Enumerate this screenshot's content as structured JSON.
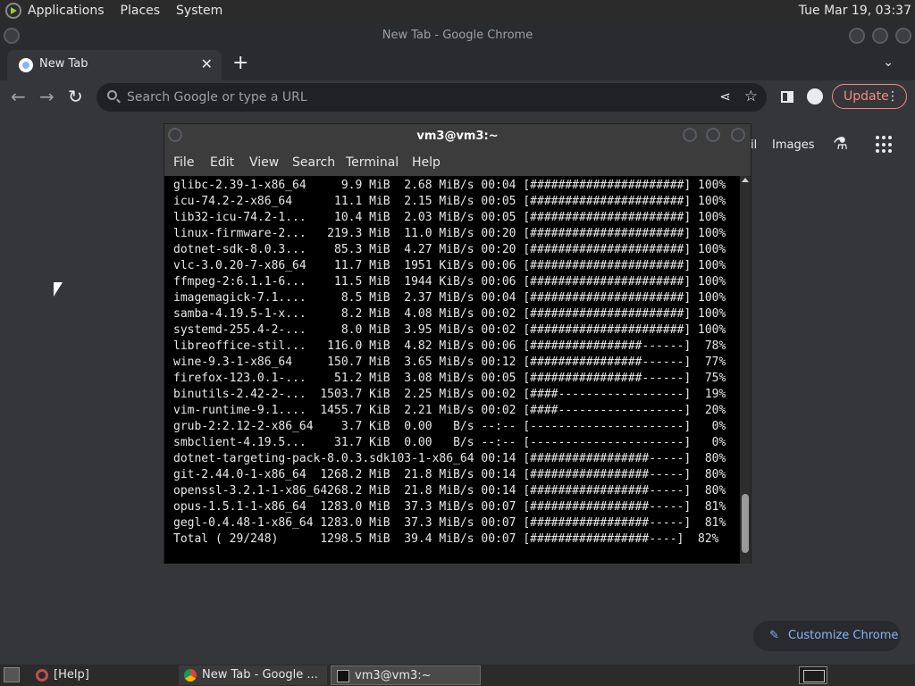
{
  "top_panel": {
    "menus": [
      "Applications",
      "Places",
      "System"
    ],
    "clock": "Tue Mar 19, 03:37"
  },
  "chrome": {
    "window_title": "New Tab - Google Chrome",
    "tab_title": "New Tab",
    "tab_close_glyph": "✕",
    "new_tab_glyph": "+",
    "omnibox_placeholder": "Search Google or type a URL",
    "update_label": "Update",
    "ntp": {
      "gmail_fragment": "il",
      "images_label": "Images",
      "customize_label": "Customize Chrome"
    }
  },
  "terminal": {
    "title": "vm3@vm3:~",
    "menus": [
      "File",
      "Edit",
      "View",
      "Search",
      "Terminal",
      "Help"
    ],
    "lines": [
      "glibc-2.39-1-x86_64     9.9 MiB  2.68 MiB/s 00:04 [######################] 100%",
      "icu-74.2-2-x86_64      11.1 MiB  2.15 MiB/s 00:05 [######################] 100%",
      "lib32-icu-74.2-1...    10.4 MiB  2.03 MiB/s 00:05 [######################] 100%",
      "linux-firmware-2...   219.3 MiB  11.0 MiB/s 00:20 [######################] 100%",
      "dotnet-sdk-8.0.3...    85.3 MiB  4.27 MiB/s 00:20 [######################] 100%",
      "vlc-3.0.20-7-x86_64    11.7 MiB  1951 KiB/s 00:06 [######################] 100%",
      "ffmpeg-2:6.1.1-6...    11.5 MiB  1944 KiB/s 00:06 [######################] 100%",
      "imagemagick-7.1....     8.5 MiB  2.37 MiB/s 00:04 [######################] 100%",
      "samba-4.19.5-1-x...     8.2 MiB  4.08 MiB/s 00:02 [######################] 100%",
      "systemd-255.4-2-...     8.0 MiB  3.95 MiB/s 00:02 [######################] 100%",
      "libreoffice-stil...   116.0 MiB  4.82 MiB/s 00:06 [################------]  78%",
      "wine-9.3-1-x86_64     150.7 MiB  3.65 MiB/s 00:12 [################------]  77%",
      "firefox-123.0.1-...    51.2 MiB  3.08 MiB/s 00:05 [################------]  75%",
      "binutils-2.42-2-...  1503.7 KiB  2.25 MiB/s 00:02 [####------------------]  19%",
      "vim-runtime-9.1....  1455.7 KiB  2.21 MiB/s 00:02 [####------------------]  20%",
      "grub-2:2.12-2-x86_64    3.7 KiB  0.00   B/s --:-- [----------------------]   0%",
      "smbclient-4.19.5...    31.7 KiB  0.00   B/s --:-- [----------------------]   0%",
      "dotnet-targeting-pack-8.0.3.sdk103-1-x86_64 00:14 [#################-----]  80%",
      "git-2.44.0-1-x86_64  1268.2 MiB  21.8 MiB/s 00:14 [#################-----]  80%",
      "openssl-3.2.1-1-x86_64268.2 MiB  21.8 MiB/s 00:14 [#################-----]  80%",
      "opus-1.5.1-1-x86_64  1283.0 MiB  37.3 MiB/s 00:07 [#################-----]  81%",
      "gegl-0.4.48-1-x86_64 1283.0 MiB  37.3 MiB/s 00:07 [#################-----]  81%",
      "Total ( 29/248)      1298.5 MiB  39.4 MiB/s 00:07 [#################----]  82%"
    ],
    "scroll_position": 0.83
  },
  "taskbar": {
    "tasks": [
      {
        "label": "[Help]",
        "icon": "help-lifebuoy-icon"
      },
      {
        "label": "New Tab - Google ...",
        "icon": "chrome-icon"
      },
      {
        "label": "vm3@vm3:~",
        "icon": "terminal-icon"
      }
    ]
  },
  "colors": {
    "chrome_bg": "#35363a",
    "accent_link": "#8ab4f8",
    "update_accent": "#f28b82",
    "terminal_bg": "#000000"
  }
}
